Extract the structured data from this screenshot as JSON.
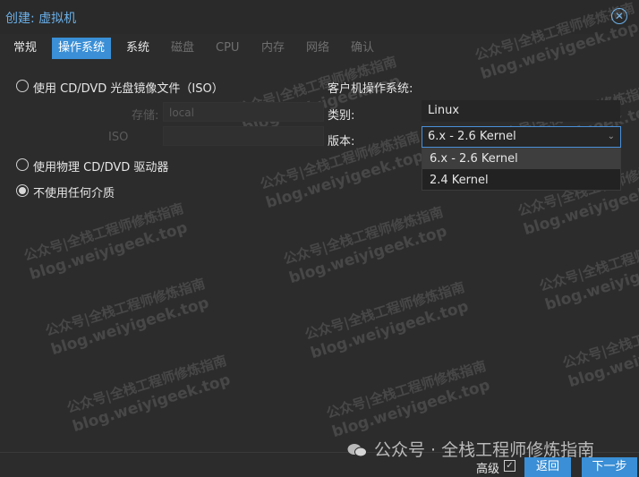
{
  "window": {
    "title": "创建: 虚拟机"
  },
  "tabs": [
    {
      "label": "常规",
      "state": "normal"
    },
    {
      "label": "操作系统",
      "state": "active"
    },
    {
      "label": "系统",
      "state": "normal"
    },
    {
      "label": "磁盘",
      "state": "disabled"
    },
    {
      "label": "CPU",
      "state": "disabled"
    },
    {
      "label": "内存",
      "state": "disabled"
    },
    {
      "label": "网络",
      "state": "disabled"
    },
    {
      "label": "确认",
      "state": "disabled"
    }
  ],
  "media": {
    "iso_option": "使用 CD/DVD 光盘镜像文件（ISO）",
    "storage_label": "存储:",
    "storage_value": "local",
    "iso_label": "ISO",
    "physical_option": "使用物理 CD/DVD 驱动器",
    "none_option": "不使用任何介质",
    "selected": "none"
  },
  "guest_os": {
    "section_title": "客户机操作系统:",
    "type_label": "类别:",
    "type_value": "Linux",
    "version_label": "版本:",
    "version_value": "6.x - 2.6 Kernel",
    "version_options": [
      "6.x - 2.6 Kernel",
      "2.4 Kernel"
    ],
    "highlighted_option": "6.x - 2.6 Kernel"
  },
  "watermark": {
    "line1": "公众号|全栈工程师修炼指南",
    "line2": "blog.weiyigeek.top"
  },
  "footer": {
    "brand_text": "公众号 · 全栈工程师修炼指南",
    "advanced_label": "高级",
    "advanced_checked": true,
    "back_label": "返回",
    "next_label": "下一步"
  },
  "colors": {
    "accent": "#3a8fd6",
    "title_text": "#6ab0e9",
    "background": "#2c2c2c"
  }
}
